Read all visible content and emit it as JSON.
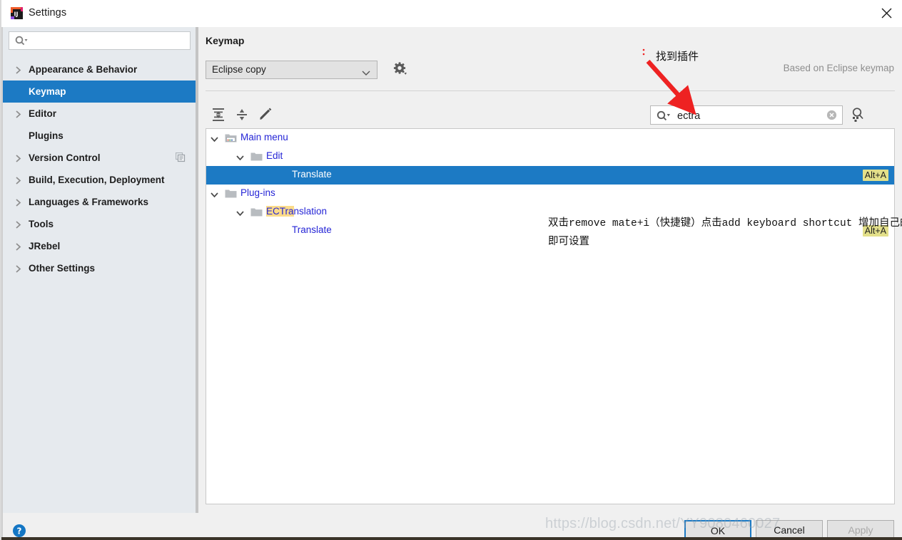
{
  "window": {
    "title": "Settings",
    "app_icon": "intellij-idea-icon",
    "close_icon": "close-icon"
  },
  "sidebar": {
    "search": {
      "value": "",
      "placeholder": "",
      "icon": "search-icon"
    },
    "items": [
      {
        "label": "Appearance & Behavior",
        "expandable": true,
        "selected": false,
        "badge": ""
      },
      {
        "label": "Keymap",
        "expandable": false,
        "selected": true,
        "badge": ""
      },
      {
        "label": "Editor",
        "expandable": true,
        "selected": false,
        "badge": ""
      },
      {
        "label": "Plugins",
        "expandable": false,
        "selected": false,
        "badge": ""
      },
      {
        "label": "Version Control",
        "expandable": true,
        "selected": false,
        "badge": "copy-icon"
      },
      {
        "label": "Build, Execution, Deployment",
        "expandable": true,
        "selected": false,
        "badge": ""
      },
      {
        "label": "Languages & Frameworks",
        "expandable": true,
        "selected": false,
        "badge": ""
      },
      {
        "label": "Tools",
        "expandable": true,
        "selected": false,
        "badge": ""
      },
      {
        "label": "JRebel",
        "expandable": true,
        "selected": false,
        "badge": ""
      },
      {
        "label": "Other Settings",
        "expandable": true,
        "selected": false,
        "badge": ""
      }
    ]
  },
  "panel": {
    "title": "Keymap",
    "keymap_select": {
      "value": "Eclipse copy",
      "caret_icon": "chevron-down-icon"
    },
    "gear_icon": "gear-icon",
    "based_on": "Based on Eclipse keymap",
    "toolbar": [
      {
        "icon": "expand-all-icon"
      },
      {
        "icon": "collapse-all-icon"
      },
      {
        "icon": "edit-pencil-icon"
      }
    ],
    "search": {
      "value": "ectra",
      "placeholder": "",
      "icon": "search-icon",
      "clear_icon": "clear-circle-icon"
    },
    "shortcut_filter_icon": "find-by-shortcut-icon"
  },
  "tree": {
    "rows": [
      {
        "label": "Main menu",
        "depth": 0,
        "chevron": "chevron-down-icon",
        "folder": "menu-folder-icon",
        "selected": false,
        "shortcut": "",
        "highlight": ""
      },
      {
        "label": "Edit",
        "depth": 1,
        "chevron": "chevron-down-icon",
        "folder": "folder-icon",
        "selected": false,
        "shortcut": "",
        "highlight": ""
      },
      {
        "label": "Translate",
        "depth": 2,
        "chevron": "",
        "folder": "",
        "selected": true,
        "shortcut": "Alt+A",
        "highlight": ""
      },
      {
        "label": "Plug-ins",
        "depth": 0,
        "chevron": "chevron-down-icon",
        "folder": "folder-icon",
        "selected": false,
        "shortcut": "",
        "highlight": ""
      },
      {
        "label": "ECTranslation",
        "depth": 1,
        "chevron": "chevron-down-icon",
        "folder": "folder-icon",
        "selected": false,
        "shortcut": "",
        "highlight": "ECTra"
      },
      {
        "label": "Translate",
        "depth": 2,
        "chevron": "",
        "folder": "",
        "selected": false,
        "shortcut": "Alt+A",
        "highlight": ""
      }
    ]
  },
  "annotations": {
    "arrow_label": "找到插件",
    "note_line1": "双击remove mate+i（快捷键）点击add keyboard shortcut 增加自己的快捷键 按住自己习惯的快捷键",
    "note_line2": "即可设置",
    "arrow_color": "#ee2222"
  },
  "footer": {
    "help_icon": "help-circle-icon",
    "ok_label": "OK",
    "cancel_label": "Cancel",
    "apply_label": "Apply",
    "watermark": "https://blog.csdn.net/YY9080460027"
  }
}
